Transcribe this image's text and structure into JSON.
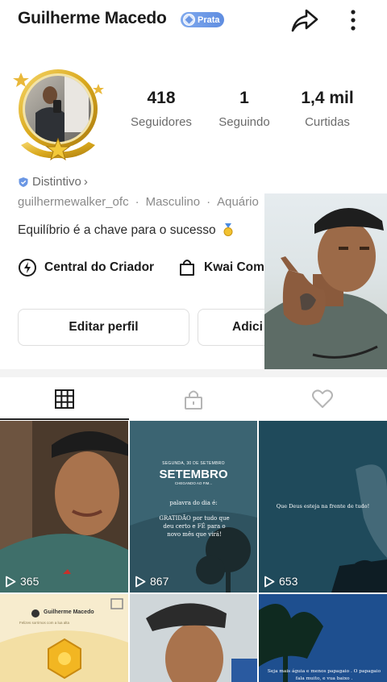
{
  "profile": {
    "name": "Guilherme Macedo",
    "badge_label": "Prata",
    "stats": [
      {
        "value": "418",
        "label": "Seguidores"
      },
      {
        "value": "1",
        "label": "Seguindo"
      },
      {
        "value": "1,4 mil",
        "label": "Curtidas"
      }
    ],
    "distintivo": "Distintivo",
    "distintivo_chevron": "›",
    "username": "guilhermewalker_ofc",
    "gender": "Masculino",
    "sign": "Aquário",
    "meta_sep": "·",
    "bio": "Equilíbrio é a chave para o sucesso"
  },
  "tools": {
    "creator": "Central do Criador",
    "shop": "Kwai Compra",
    "overflow_hint": "s"
  },
  "actions": {
    "edit": "Editar perfil",
    "add": "Adici"
  },
  "tabs": [
    "posts-grid",
    "private",
    "likes"
  ],
  "posts": [
    {
      "views": "365"
    },
    {
      "views": "867",
      "date": "SEGUNDA, 30 DE SETEMBRO",
      "title": "SETEMBRO",
      "subtitle": "CHEGANDO AO FIM...",
      "word_label": "palavra do dia é:",
      "word_text": "GRATIDÃO por tudo que deu certo e FÉ para o novo mês que virá!"
    },
    {
      "views": "653",
      "text": "Que Deus esteja na frente de tudo!"
    },
    {
      "author": "Guilherme Macedo",
      "line": "Felizes sorrimos com a lua alta"
    },
    {},
    {
      "text": "Seja mais águia e menos papagaio . O papagaio fala muito, e vua baixo ."
    }
  ],
  "colors": {
    "badge": "#6b97e4",
    "gold": "#d9a81c",
    "text": "#1b1b1b",
    "muted": "#6b6b6b"
  }
}
